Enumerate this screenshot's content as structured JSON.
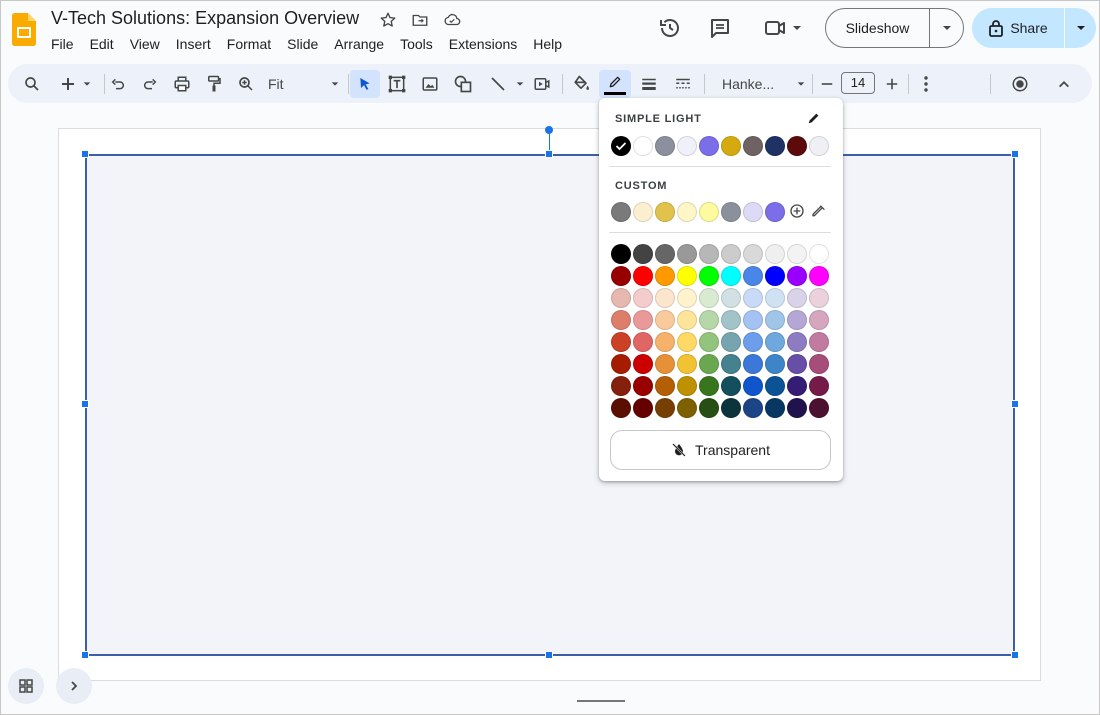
{
  "app": {
    "doc_title": "V-Tech Solutions: Expansion Overview",
    "icons": [
      "star-icon",
      "move-to-folder-icon",
      "cloud-status-icon"
    ]
  },
  "menu": [
    "File",
    "Edit",
    "View",
    "Insert",
    "Format",
    "Slide",
    "Arrange",
    "Tools",
    "Extensions",
    "Help"
  ],
  "header": {
    "slideshow_label": "Slideshow",
    "share_label": "Share"
  },
  "toolbar": {
    "zoom_value": "Fit",
    "font_name": "Hanke...",
    "font_size": "14",
    "icons": [
      "search-icon",
      "new-slide-icon",
      "undo-icon",
      "redo-icon",
      "print-icon",
      "paint-format-icon",
      "zoom-icon",
      "select-icon",
      "text-box-icon",
      "image-icon",
      "shape-icon",
      "line-icon",
      "video-icon",
      "fill-color-icon",
      "border-color-icon",
      "border-weight-icon",
      "border-dash-icon",
      "decrease-font-icon",
      "increase-font-icon",
      "more-icon",
      "record-icon",
      "collapse-icon"
    ],
    "border_color_indicator": "#000000"
  },
  "picker": {
    "theme_label": "SIMPLE LIGHT",
    "custom_label": "CUSTOM",
    "transparent_label": "Transparent",
    "theme_colors": [
      "#000000",
      "#ffffff",
      "#8a909d",
      "#f0f1f8",
      "#7b6ee8",
      "#d4aa10",
      "#6f6263",
      "#1e3264",
      "#5c0a0a",
      "#eef0f5"
    ],
    "selected_theme_color": "#000000",
    "custom_colors": [
      "#7a7a7a",
      "#fcefd0",
      "#e1c24c",
      "#fdf6c7",
      "#fdfaa0",
      "#8a919d",
      "#dcdaf7",
      "#7b6ee8"
    ],
    "grid": [
      [
        "#000000",
        "#434343",
        "#666666",
        "#999999",
        "#b7b7b7",
        "#cccccc",
        "#d9d9d9",
        "#efefef",
        "#f3f3f3",
        "#ffffff"
      ],
      [
        "#980000",
        "#ff0000",
        "#ff9900",
        "#ffff00",
        "#00ff00",
        "#00ffff",
        "#4a86e8",
        "#0000ff",
        "#9900ff",
        "#ff00ff"
      ],
      [
        "#e6b8af",
        "#f4cccc",
        "#fce5cd",
        "#fff2cc",
        "#d9ead3",
        "#d0e0e3",
        "#c9daf8",
        "#cfe2f3",
        "#d9d2e9",
        "#ead1dc"
      ],
      [
        "#dd7e6b",
        "#ea9999",
        "#f9cb9c",
        "#ffe599",
        "#b6d7a8",
        "#a2c4c9",
        "#a4c2f4",
        "#9fc5e8",
        "#b4a7d6",
        "#d5a6bd"
      ],
      [
        "#cc4125",
        "#e06666",
        "#f6b26b",
        "#ffd966",
        "#93c47d",
        "#76a5af",
        "#6d9eeb",
        "#6fa8dc",
        "#8e7cc3",
        "#c27ba0"
      ],
      [
        "#a61c00",
        "#cc0000",
        "#e69138",
        "#f1c232",
        "#6aa84f",
        "#45818e",
        "#3c78d8",
        "#3d85c6",
        "#674ea7",
        "#a64d79"
      ],
      [
        "#85200c",
        "#990000",
        "#b45f06",
        "#bf9000",
        "#38761d",
        "#134f5c",
        "#1155cc",
        "#0b5394",
        "#351c75",
        "#741b47"
      ],
      [
        "#5b0f00",
        "#660000",
        "#783f04",
        "#7f6000",
        "#274e13",
        "#0c343d",
        "#1c4587",
        "#073763",
        "#20124d",
        "#4c1130"
      ]
    ]
  },
  "slide": {
    "shape_fill": "#f3f4f9",
    "shape_border": "#3d5fa9"
  }
}
